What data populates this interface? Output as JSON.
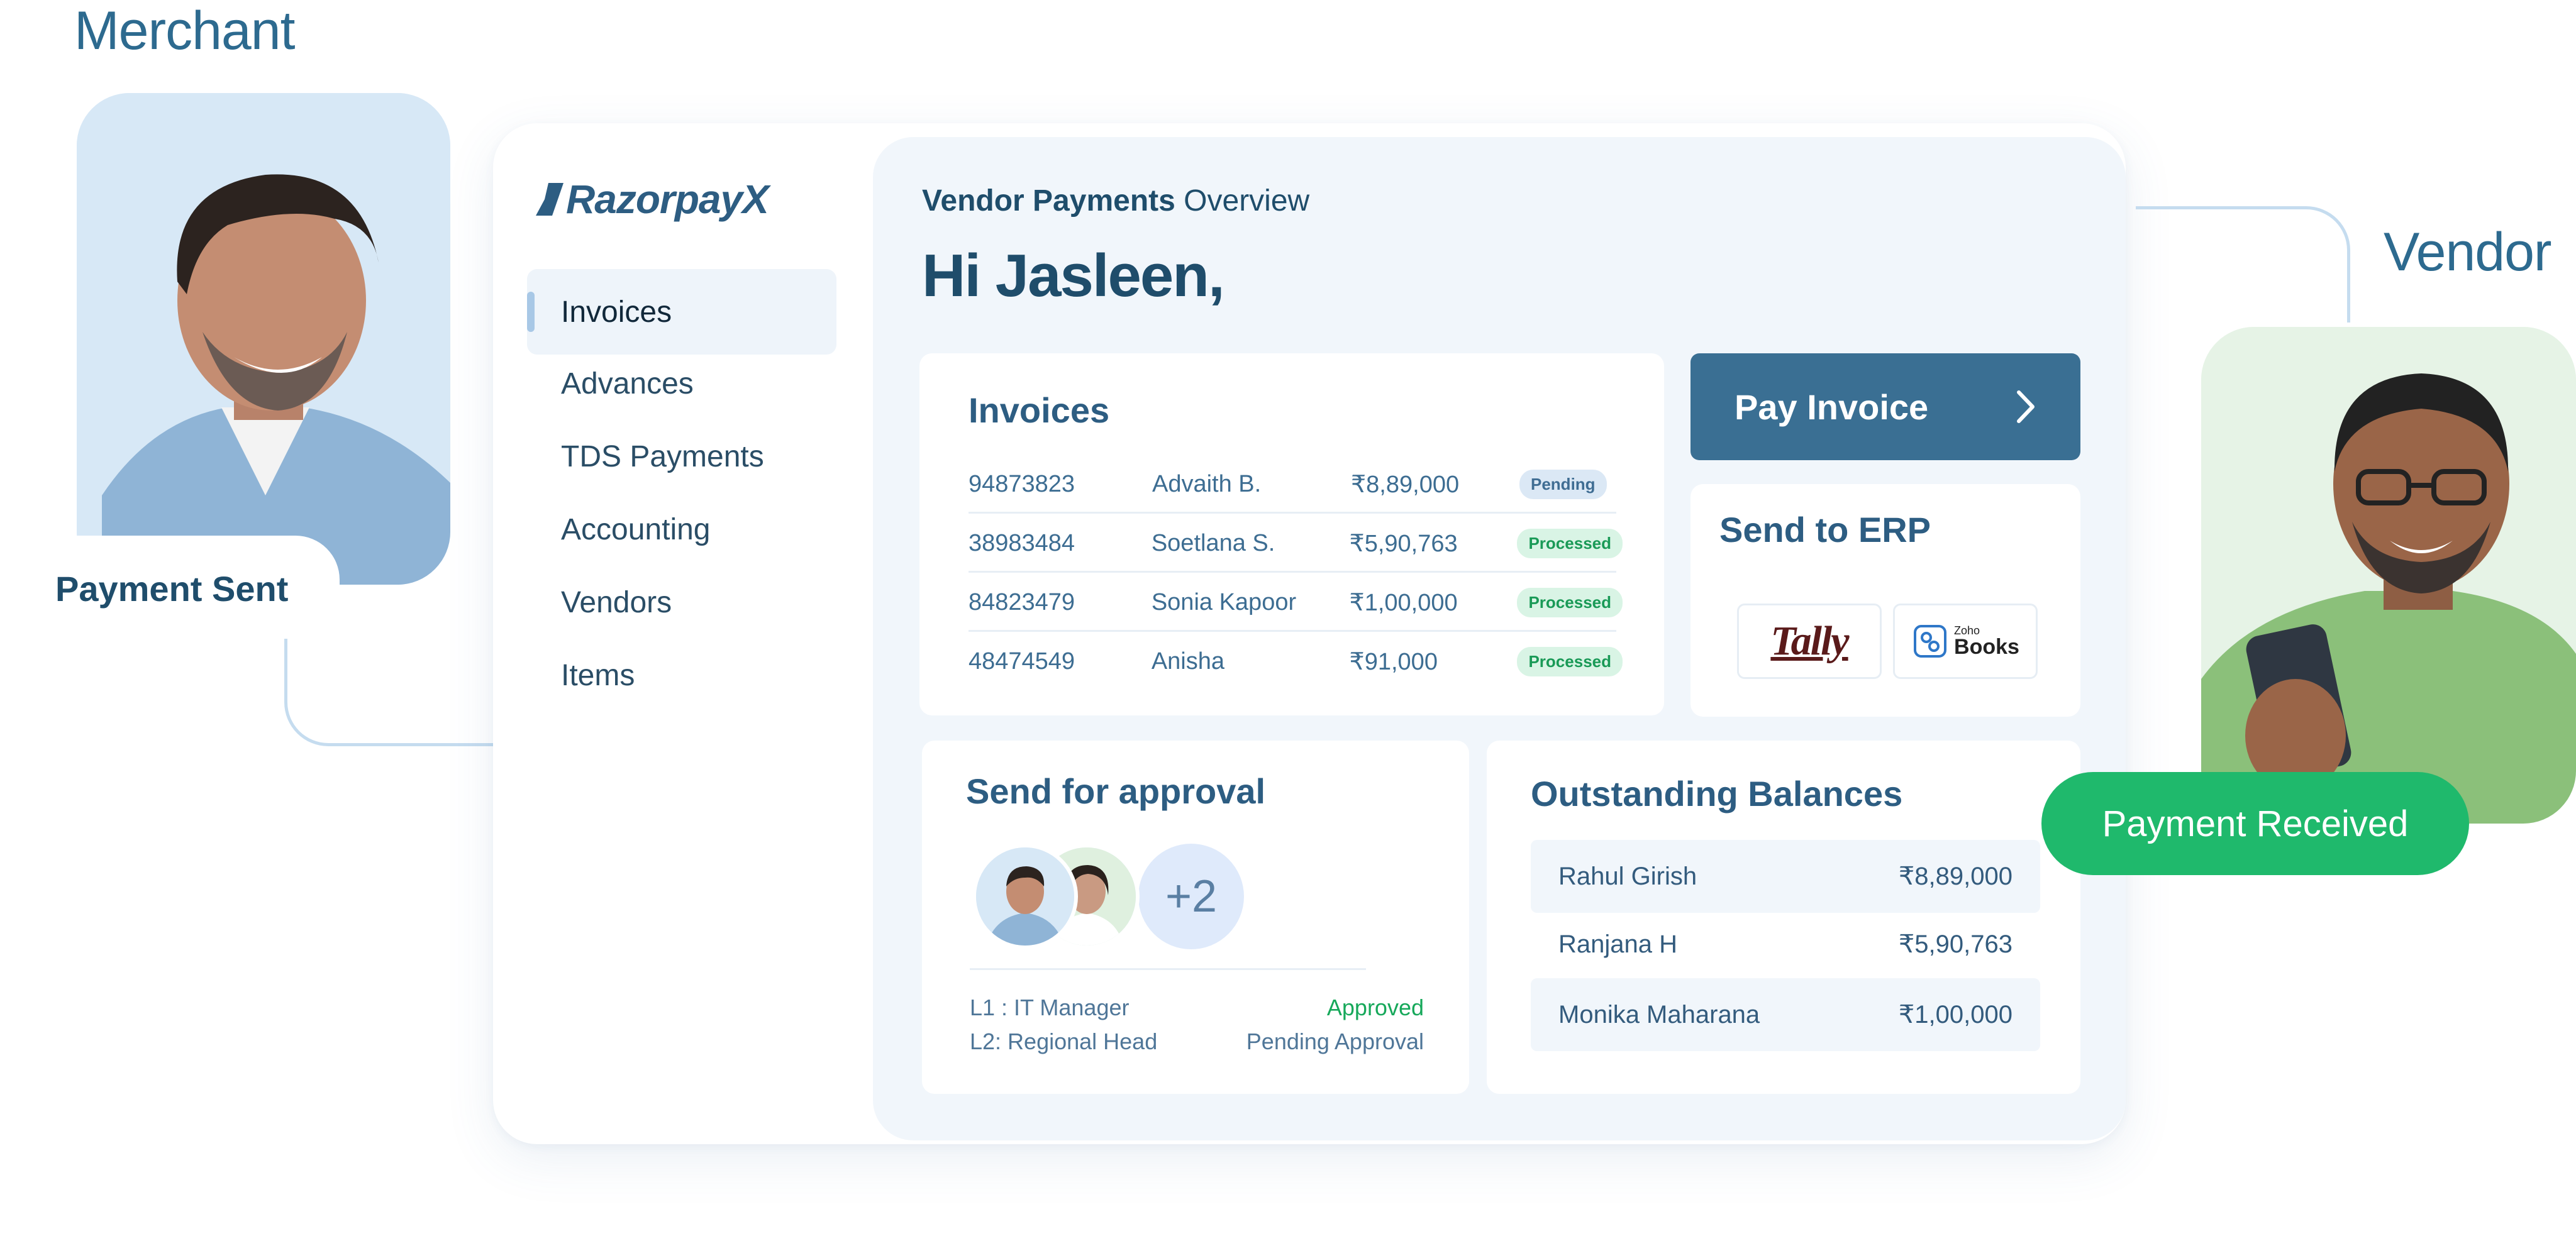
{
  "labels": {
    "merchant": "Merchant",
    "vendor": "Vendor",
    "payment_sent": "Payment Sent",
    "payment_received": "Payment Received"
  },
  "app": {
    "brand": "RazorpayX",
    "nav": [
      {
        "label": "Invoices",
        "active": true
      },
      {
        "label": "Advances"
      },
      {
        "label": "TDS Payments"
      },
      {
        "label": "Accounting"
      },
      {
        "label": "Vendors"
      },
      {
        "label": "Items"
      }
    ],
    "header": {
      "title_bold": "Vendor Payments",
      "title_rest": " Overview",
      "greeting": "Hi Jasleen,"
    },
    "invoices": {
      "title": "Invoices",
      "rows": [
        {
          "id": "94873823",
          "name": "Advaith B.",
          "amount": "₹8,89,000",
          "status": "Pending"
        },
        {
          "id": "38983484",
          "name": "Soetlana S.",
          "amount": "₹5,90,763",
          "status": "Processed"
        },
        {
          "id": "84823479",
          "name": "Sonia Kapoor",
          "amount": "₹1,00,000",
          "status": "Processed"
        },
        {
          "id": "48474549",
          "name": "Anisha",
          "amount": "₹91,000",
          "status": "Processed"
        }
      ]
    },
    "pay_invoice": {
      "label": "Pay Invoice"
    },
    "erp": {
      "title": "Send to ERP",
      "logos": [
        {
          "name": "Tally"
        },
        {
          "brand_small": "Zoho",
          "brand_big": "Books"
        }
      ]
    },
    "approval": {
      "title": "Send for approval",
      "extra_count": "+2",
      "levels": [
        {
          "level": "L1 :  IT Manager",
          "status": "Approved"
        },
        {
          "level": "L2: Regional Head",
          "status": "Pending Approval"
        }
      ]
    },
    "balances": {
      "title": "Outstanding Balances",
      "rows": [
        {
          "name": "Rahul Girish",
          "amount": "₹8,89,000"
        },
        {
          "name": "Ranjana H",
          "amount": "₹5,90,763"
        },
        {
          "name": "Monika Maharana",
          "amount": "₹1,00,000"
        }
      ]
    }
  },
  "colors": {
    "accent": "#3a6f93",
    "text_primary": "#1f4d6b",
    "success": "#1fb96c",
    "pending_badge": "#dbe8f5",
    "processed_badge": "#d9f4e5"
  }
}
